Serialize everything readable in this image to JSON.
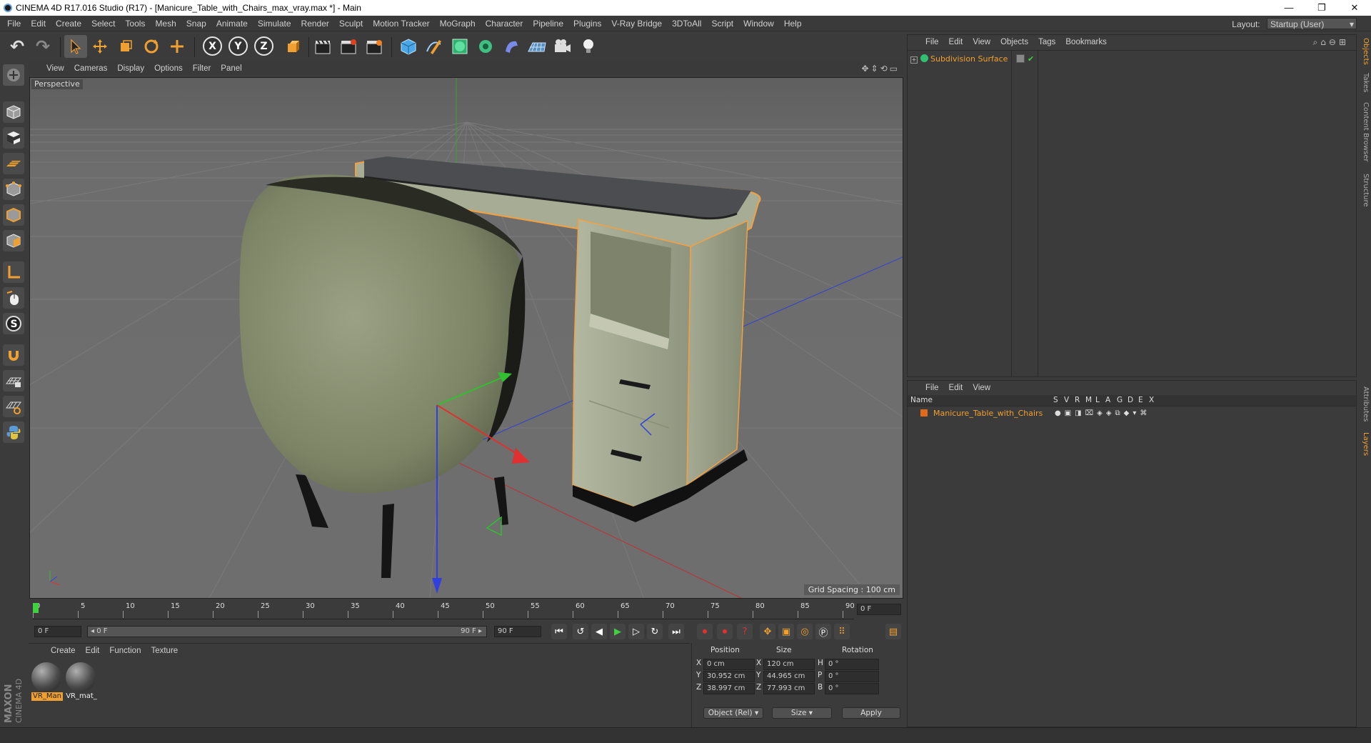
{
  "window": {
    "title": "CINEMA 4D R17.016 Studio (R17) - [Manicure_Table_with_Chairs_max_vray.max *] - Main",
    "minimize": "—",
    "restore": "❐",
    "close": "✕"
  },
  "menubar": {
    "items": [
      "File",
      "Edit",
      "Create",
      "Select",
      "Tools",
      "Mesh",
      "Snap",
      "Animate",
      "Simulate",
      "Render",
      "Sculpt",
      "Motion Tracker",
      "MoGraph",
      "Character",
      "Pipeline",
      "Plugins",
      "V-Ray Bridge",
      "3DToAll",
      "Script",
      "Window",
      "Help"
    ],
    "layout_label": "Layout:",
    "layout_value": "Startup (User)"
  },
  "toolbar": {
    "undo": "↶",
    "redo": "↷",
    "axis_x": "X",
    "axis_y": "Y",
    "axis_z": "Z"
  },
  "viewport": {
    "menu": [
      "View",
      "Cameras",
      "Display",
      "Options",
      "Filter",
      "Panel"
    ],
    "label": "Perspective",
    "grid_spacing": "Grid Spacing : 100 cm"
  },
  "timeline": {
    "ticks": [
      "0",
      "5",
      "10",
      "15",
      "20",
      "25",
      "30",
      "35",
      "40",
      "45",
      "50",
      "55",
      "60",
      "65",
      "70",
      "75",
      "80",
      "85",
      "90"
    ],
    "current_frame": "0 F",
    "start_field": "0 F",
    "range_start": "◂ 0 F",
    "range_end": "90 F ▸",
    "end_field": "90 F"
  },
  "material_manager": {
    "menu": [
      "Create",
      "Edit",
      "Function",
      "Texture"
    ],
    "materials": [
      {
        "name": "VR_Man",
        "selected": true
      },
      {
        "name": "VR_mat_",
        "selected": false
      }
    ]
  },
  "coordinates": {
    "headers": {
      "position": "Position",
      "size": "Size",
      "rotation": "Rotation"
    },
    "rows": [
      {
        "axis": "X",
        "pos": "0 cm",
        "size_axis": "X",
        "size": "120 cm",
        "rot_axis": "H",
        "rot": "0 °"
      },
      {
        "axis": "Y",
        "pos": "30.952 cm",
        "size_axis": "Y",
        "size": "44.965 cm",
        "rot_axis": "P",
        "rot": "0 °"
      },
      {
        "axis": "Z",
        "pos": "38.997 cm",
        "size_axis": "Z",
        "size": "77.993 cm",
        "rot_axis": "B",
        "rot": "0 °"
      }
    ],
    "mode": "Object (Rel)",
    "size_mode": "Size",
    "apply": "Apply"
  },
  "object_manager": {
    "menu": [
      "File",
      "Edit",
      "View",
      "Objects",
      "Tags",
      "Bookmarks"
    ],
    "objects": [
      {
        "name": "Subdivision Surface"
      }
    ]
  },
  "layer_manager": {
    "menu": [
      "File",
      "Edit",
      "View"
    ],
    "columns": [
      "Name",
      "S",
      "V",
      "R",
      "M",
      "L",
      "A",
      "G",
      "D",
      "E",
      "X"
    ],
    "layers": [
      {
        "name": "Manicure_Table_with_Chairs",
        "color": "#e06a1a"
      }
    ]
  },
  "right_tabs": [
    "Objects",
    "Takes",
    "Content Browser",
    "Structure",
    "Attributes",
    "Layers"
  ],
  "maxon_brand": "MAXON CINEMA 4D",
  "colors": {
    "accent_orange": "#f0a030",
    "selection_outline": "#f5a040",
    "axis_x": "#e03030",
    "axis_y": "#30c030",
    "axis_z": "#3040e0",
    "play_green": "#40d040"
  }
}
